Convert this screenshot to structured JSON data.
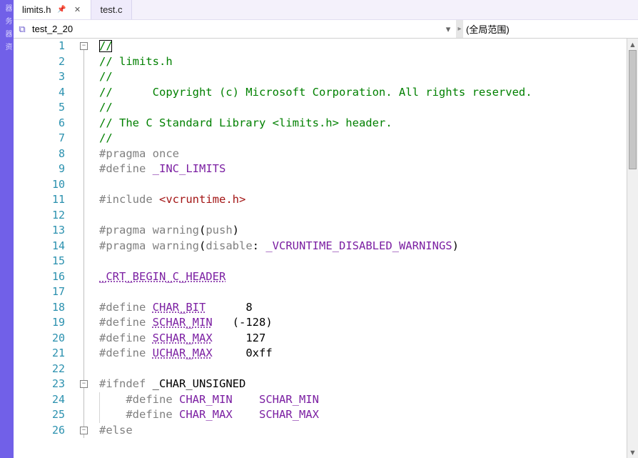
{
  "tabs": [
    {
      "label": "limits.h",
      "active": true,
      "pinned": true,
      "closable": true
    },
    {
      "label": "test.c",
      "active": false,
      "pinned": false,
      "closable": false
    }
  ],
  "nav": {
    "type_icon": "⧉",
    "scope_left": "test_2_20",
    "scope_right": "(全局范围)"
  },
  "scroll": {
    "thumb_top_pct": 0,
    "thumb_height_pct": 30
  },
  "code": {
    "lines": [
      {
        "n": 1,
        "fold": "minus",
        "tokens": [
          {
            "t": "//",
            "c": "comment"
          }
        ],
        "cursor": true
      },
      {
        "n": 2,
        "tokens": [
          {
            "t": "// limits.h",
            "c": "comment"
          }
        ]
      },
      {
        "n": 3,
        "tokens": [
          {
            "t": "//",
            "c": "comment"
          }
        ]
      },
      {
        "n": 4,
        "tokens": [
          {
            "t": "//      Copyright (c) Microsoft Corporation. All rights reserved.",
            "c": "comment"
          }
        ]
      },
      {
        "n": 5,
        "tokens": [
          {
            "t": "//",
            "c": "comment"
          }
        ]
      },
      {
        "n": 6,
        "tokens": [
          {
            "t": "// The C Standard Library <limits.h> header.",
            "c": "comment"
          }
        ]
      },
      {
        "n": 7,
        "tokens": [
          {
            "t": "//",
            "c": "comment"
          }
        ]
      },
      {
        "n": 8,
        "tokens": [
          {
            "t": "#pragma",
            "c": "pre"
          },
          {
            "t": " ",
            "c": "plain"
          },
          {
            "t": "once",
            "c": "pre"
          }
        ]
      },
      {
        "n": 9,
        "tokens": [
          {
            "t": "#define",
            "c": "pre"
          },
          {
            "t": " ",
            "c": "plain"
          },
          {
            "t": "_INC_LIMITS",
            "c": "macro"
          }
        ]
      },
      {
        "n": 10,
        "tokens": []
      },
      {
        "n": 11,
        "tokens": [
          {
            "t": "#include",
            "c": "pre"
          },
          {
            "t": " ",
            "c": "plain"
          },
          {
            "t": "<vcruntime.h>",
            "c": "str"
          }
        ]
      },
      {
        "n": 12,
        "tokens": []
      },
      {
        "n": 13,
        "tokens": [
          {
            "t": "#pragma",
            "c": "pre"
          },
          {
            "t": " ",
            "c": "plain"
          },
          {
            "t": "warning",
            "c": "pre"
          },
          {
            "t": "(",
            "c": "plain"
          },
          {
            "t": "push",
            "c": "pre"
          },
          {
            "t": ")",
            "c": "plain"
          }
        ]
      },
      {
        "n": 14,
        "tokens": [
          {
            "t": "#pragma",
            "c": "pre"
          },
          {
            "t": " ",
            "c": "plain"
          },
          {
            "t": "warning",
            "c": "pre"
          },
          {
            "t": "(",
            "c": "plain"
          },
          {
            "t": "disable",
            "c": "pre"
          },
          {
            "t": ": ",
            "c": "plain"
          },
          {
            "t": "_VCRUNTIME_DISABLED_WARNINGS",
            "c": "macro"
          },
          {
            "t": ")",
            "c": "plain"
          }
        ]
      },
      {
        "n": 15,
        "tokens": []
      },
      {
        "n": 16,
        "tokens": [
          {
            "t": "_CRT_BEGIN_C_HEADER",
            "c": "macro",
            "dotted": true
          }
        ]
      },
      {
        "n": 17,
        "tokens": []
      },
      {
        "n": 18,
        "tokens": [
          {
            "t": "#define",
            "c": "pre"
          },
          {
            "t": " ",
            "c": "plain"
          },
          {
            "t": "CHAR_BIT",
            "c": "macro",
            "dotted": true
          },
          {
            "t": "      8",
            "c": "plain"
          }
        ]
      },
      {
        "n": 19,
        "tokens": [
          {
            "t": "#define",
            "c": "pre"
          },
          {
            "t": " ",
            "c": "plain"
          },
          {
            "t": "SCHAR_MIN",
            "c": "macro",
            "dotted": true
          },
          {
            "t": "   (-128)",
            "c": "plain"
          }
        ]
      },
      {
        "n": 20,
        "tokens": [
          {
            "t": "#define",
            "c": "pre"
          },
          {
            "t": " ",
            "c": "plain"
          },
          {
            "t": "SCHAR_MAX",
            "c": "macro",
            "dotted": true
          },
          {
            "t": "     127",
            "c": "plain"
          }
        ]
      },
      {
        "n": 21,
        "tokens": [
          {
            "t": "#define",
            "c": "pre"
          },
          {
            "t": " ",
            "c": "plain"
          },
          {
            "t": "UCHAR_MAX",
            "c": "macro",
            "dotted": true
          },
          {
            "t": "     0xff",
            "c": "plain"
          }
        ]
      },
      {
        "n": 22,
        "tokens": []
      },
      {
        "n": 23,
        "fold": "minus",
        "tokens": [
          {
            "t": "#ifndef",
            "c": "pre"
          },
          {
            "t": " ",
            "c": "plain"
          },
          {
            "t": "_CHAR_UNSIGNED",
            "c": "plain"
          }
        ]
      },
      {
        "n": 24,
        "indent": 1,
        "tokens": [
          {
            "t": "    #define",
            "c": "pre"
          },
          {
            "t": " ",
            "c": "plain"
          },
          {
            "t": "CHAR_MIN",
            "c": "macro"
          },
          {
            "t": "    ",
            "c": "plain"
          },
          {
            "t": "SCHAR_MIN",
            "c": "macro"
          }
        ]
      },
      {
        "n": 25,
        "indent": 1,
        "tokens": [
          {
            "t": "    #define",
            "c": "pre"
          },
          {
            "t": " ",
            "c": "plain"
          },
          {
            "t": "CHAR_MAX",
            "c": "macro"
          },
          {
            "t": "    ",
            "c": "plain"
          },
          {
            "t": "SCHAR_MAX",
            "c": "macro"
          }
        ]
      },
      {
        "n": 26,
        "fold": "minus",
        "tokens": [
          {
            "t": "#else",
            "c": "pre"
          }
        ]
      }
    ]
  },
  "icons": {
    "pin": "📌",
    "close": "✕",
    "chevron_down": "▾",
    "tri_up": "▴",
    "tri_down": "▾",
    "separator": "▸",
    "minus": "−"
  }
}
